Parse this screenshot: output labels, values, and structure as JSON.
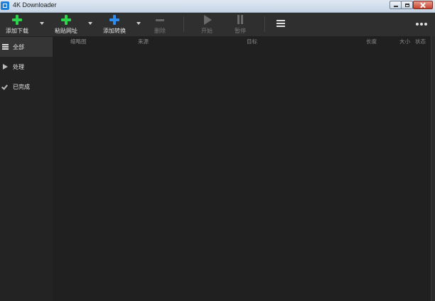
{
  "window": {
    "title": "4K Downloader"
  },
  "toolbar": {
    "add_download": "添加下载",
    "paste_url": "粘贴网址",
    "add_convert": "添加转换",
    "delete": "删除",
    "start": "开始",
    "pause": "暂停",
    "menu_icon": "hamburger-menu-icon",
    "more_icon": "more-dots-icon"
  },
  "sidebar": {
    "items": [
      {
        "label": "全部",
        "icon": "list-icon",
        "active": true
      },
      {
        "label": "处理",
        "icon": "play-icon",
        "active": false
      },
      {
        "label": "已完成",
        "icon": "check-icon",
        "active": false
      }
    ]
  },
  "table": {
    "columns": [
      "缩略图",
      "来源",
      "目标",
      "长度",
      "大小",
      "状态"
    ],
    "rows": []
  },
  "colors": {
    "accent_green": "#2bd44a",
    "accent_blue": "#2f8df0",
    "background": "#202020"
  }
}
